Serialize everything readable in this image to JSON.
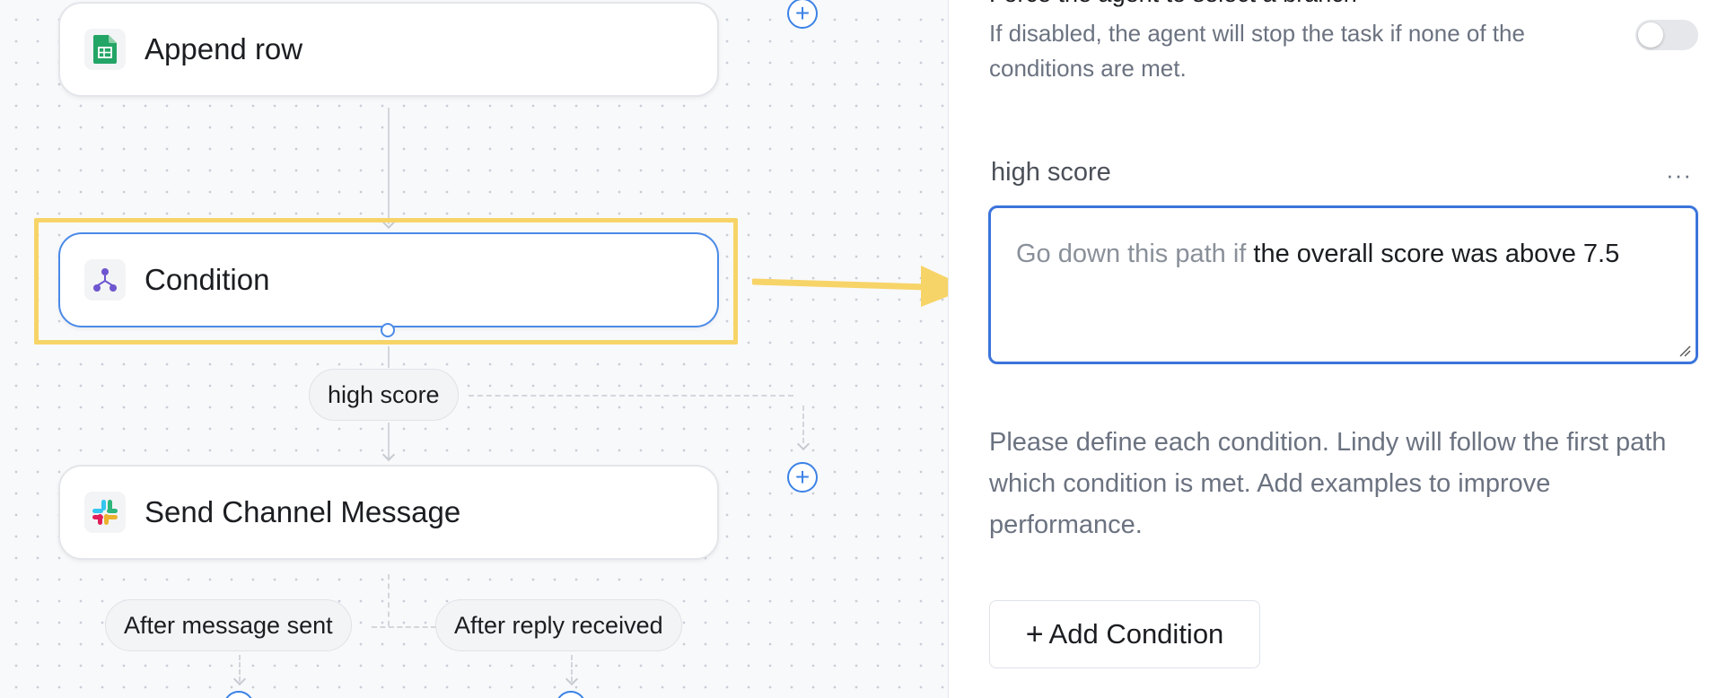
{
  "canvas": {
    "nodes": [
      {
        "id": "append-row",
        "title": "Append row",
        "icon": "google-sheets-icon"
      },
      {
        "id": "condition",
        "title": "Condition",
        "icon": "branch-icon"
      },
      {
        "id": "send-channel-message",
        "title": "Send Channel Message",
        "icon": "slack-icon"
      }
    ],
    "branch_label": "high score",
    "trigger_labels": {
      "after_message_sent": "After message sent",
      "after_reply_received": "After reply received"
    },
    "add_step_symbol": "+"
  },
  "panel": {
    "force_branch_title": "Force the agent to select a branch",
    "force_branch_desc": "If disabled, the agent will stop the task if none of the conditions are met.",
    "force_branch_enabled": false,
    "condition": {
      "name": "high score",
      "menu_symbol": "···",
      "placeholder": "Go down this path if",
      "value": "the overall score was above 7.5"
    },
    "help_text": "Please define each condition. Lindy will follow the first path which condition is met. Add examples to improve performance.",
    "add_condition_label": "Add Condition",
    "add_condition_symbol": "+"
  },
  "colors": {
    "accent": "#3b74db",
    "highlight": "#f7d468",
    "sheets_green": "#23a566",
    "branch_purple": "#6e56cf"
  }
}
